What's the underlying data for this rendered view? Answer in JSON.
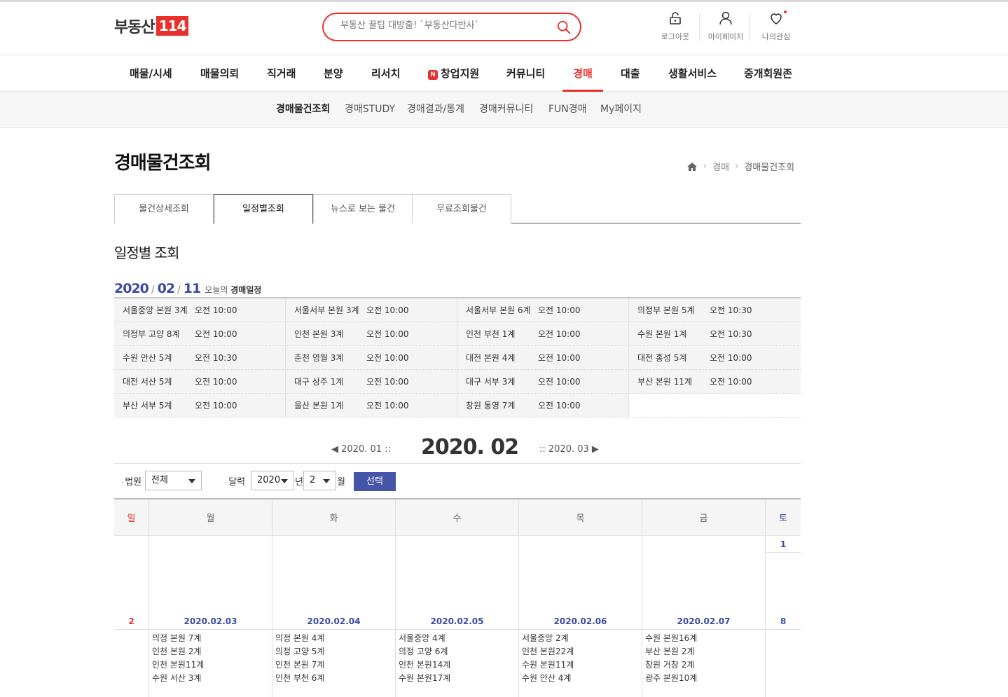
{
  "header": {
    "logo_text": "부동산",
    "logo_num": "114",
    "search_placeholder": "부동산 꿀팁 대방출! `부동산다반사`",
    "util": [
      "로그아웃",
      "마이페이지",
      "나의관심"
    ]
  },
  "gnb": {
    "items": [
      "매물/시세",
      "매물의뢰",
      "직거래",
      "분양",
      "리서치",
      "창업지원",
      "커뮤니티",
      "경매",
      "대출",
      "생활서비스",
      "중개회원존"
    ],
    "badge": "N",
    "active": "경매"
  },
  "lnb": {
    "items": [
      "경매물건조회",
      "경매STUDY",
      "경매결과/통계",
      "경매커뮤니티",
      "FUN경매",
      "My페이지"
    ]
  },
  "page": {
    "title": "경매물건조회",
    "breadcrumb": [
      "경매",
      "경매물건조회"
    ],
    "tabs": [
      "물건상세조회",
      "일정별조회",
      "뉴스로 보는 물건",
      "무료조회물건"
    ],
    "section_title": "일정별 조회"
  },
  "today": {
    "year": "2020",
    "month": "02",
    "day": "11",
    "label_prefix": "오늘의",
    "label_bold": "경매일정"
  },
  "schedule": [
    [
      {
        "c": "서울중앙 본원 3계",
        "t": "오전 10:00"
      },
      {
        "c": "서울서부 본원 3계",
        "t": "오전 10:00"
      },
      {
        "c": "서울서부 본원 6계",
        "t": "오전 10:00"
      },
      {
        "c": "의정부 본원 5계",
        "t": "오전 10:30"
      }
    ],
    [
      {
        "c": "의정부 고양 8계",
        "t": "오전 10:00"
      },
      {
        "c": "인천 본원 3계",
        "t": "오전 10:00"
      },
      {
        "c": "인천 부천 1계",
        "t": "오전 10:00"
      },
      {
        "c": "수원 본원 1계",
        "t": "오전 10:30"
      }
    ],
    [
      {
        "c": "수원 안산 5계",
        "t": "오전 10:30"
      },
      {
        "c": "춘천 영월 3계",
        "t": "오전 10:00"
      },
      {
        "c": "대전 본원 4계",
        "t": "오전 10:00"
      },
      {
        "c": "대전 홍성 5계",
        "t": "오전 10:00"
      }
    ],
    [
      {
        "c": "대전 서산 5계",
        "t": "오전 10:00"
      },
      {
        "c": "대구 상주 1계",
        "t": "오전 10:00"
      },
      {
        "c": "대구 서부 3계",
        "t": "오전 10:00"
      },
      {
        "c": "부산 본원 11계",
        "t": "오전 10:00"
      }
    ],
    [
      {
        "c": "부산 서부 5계",
        "t": "오전 10:00"
      },
      {
        "c": "울산 본원 1계",
        "t": "오전 10:00"
      },
      {
        "c": "창원 통영 7계",
        "t": "오전 10:00"
      },
      {
        "c": "",
        "t": ""
      }
    ]
  ],
  "month_nav": {
    "prev": "◀ 2020. 01 ::",
    "current": "2020. 02",
    "next": ":: 2020. 03 ▶"
  },
  "filters": {
    "court_label": "법원",
    "court_value": "전체",
    "cal_label": "달력",
    "year_value": "2020",
    "year_unit": "년",
    "month_value": "2",
    "month_unit": "월",
    "button": "선택"
  },
  "calendar": {
    "headers": [
      "일",
      "월",
      "화",
      "수",
      "목",
      "금",
      "토"
    ],
    "week1": {
      "sat": "1"
    },
    "week2": {
      "sun": "2",
      "days": [
        {
          "date": "2020.02.03",
          "events": [
            "의정 본원 7계",
            "인천 본원 2계",
            "인천 본원11계",
            "수원 서산 3계"
          ]
        },
        {
          "date": "2020.02.04",
          "events": [
            "의정 본원 4계",
            "의정 고양 5계",
            "인천 본원 7계",
            "인천 부천 6계"
          ]
        },
        {
          "date": "2020.02.05",
          "events": [
            "서울중앙  4계",
            "의정 고양 6계",
            "인천 본원14계",
            "수원 본원17계"
          ]
        },
        {
          "date": "2020.02.06",
          "events": [
            "서울중앙  2계",
            "인천 본원22계",
            "수원 본원11계",
            "수원 안산 4계"
          ]
        },
        {
          "date": "2020.02.07",
          "events": [
            "수원 본원16계",
            "부산 본원 2계",
            "창원 거창 2계",
            "광주 본원10계"
          ]
        }
      ],
      "sat": "8"
    }
  },
  "colors": {
    "accent": "#e8312b",
    "blue": "#3b4ba5",
    "button": "#4555a8"
  }
}
